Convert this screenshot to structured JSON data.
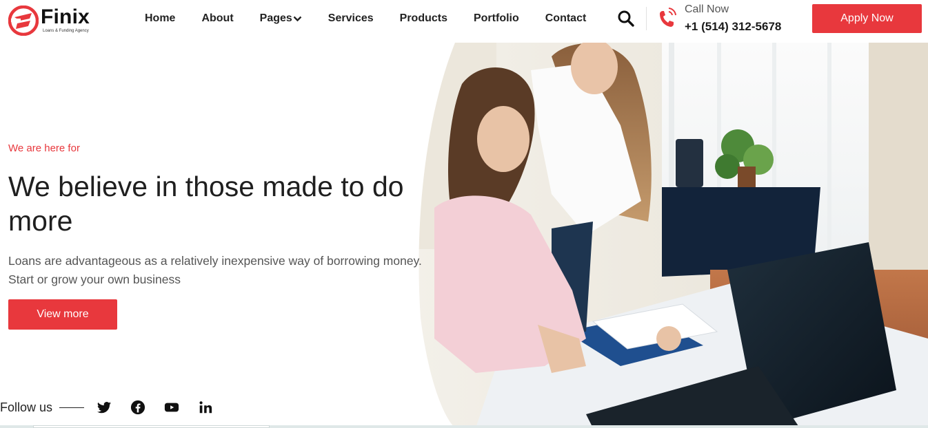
{
  "brand": {
    "name": "Finix",
    "tagline": "Loans & Funding Agency",
    "accent": "#e8383d"
  },
  "nav": {
    "items": [
      {
        "label": "Home"
      },
      {
        "label": "About"
      },
      {
        "label": "Pages",
        "has_dropdown": true
      },
      {
        "label": "Services"
      },
      {
        "label": "Products"
      },
      {
        "label": "Portfolio"
      },
      {
        "label": "Contact"
      }
    ]
  },
  "header": {
    "search_icon": "search-icon",
    "call_label": "Call Now",
    "call_number": "+1 (514) 312-5678",
    "apply_label": "Apply Now"
  },
  "hero": {
    "eyebrow": "We are here for",
    "headline": "We believe in those made to do more",
    "lead_line1": "Loans are advantageous as a relatively inexpensive way of borrowing money.",
    "lead_line2": "Start or grow your own business",
    "cta_label": "View more",
    "photo": "two-women-office-laptop-photo"
  },
  "social": {
    "label": "Follow us",
    "icons": [
      "twitter-icon",
      "facebook-icon",
      "youtube-icon",
      "linkedin-icon"
    ]
  }
}
